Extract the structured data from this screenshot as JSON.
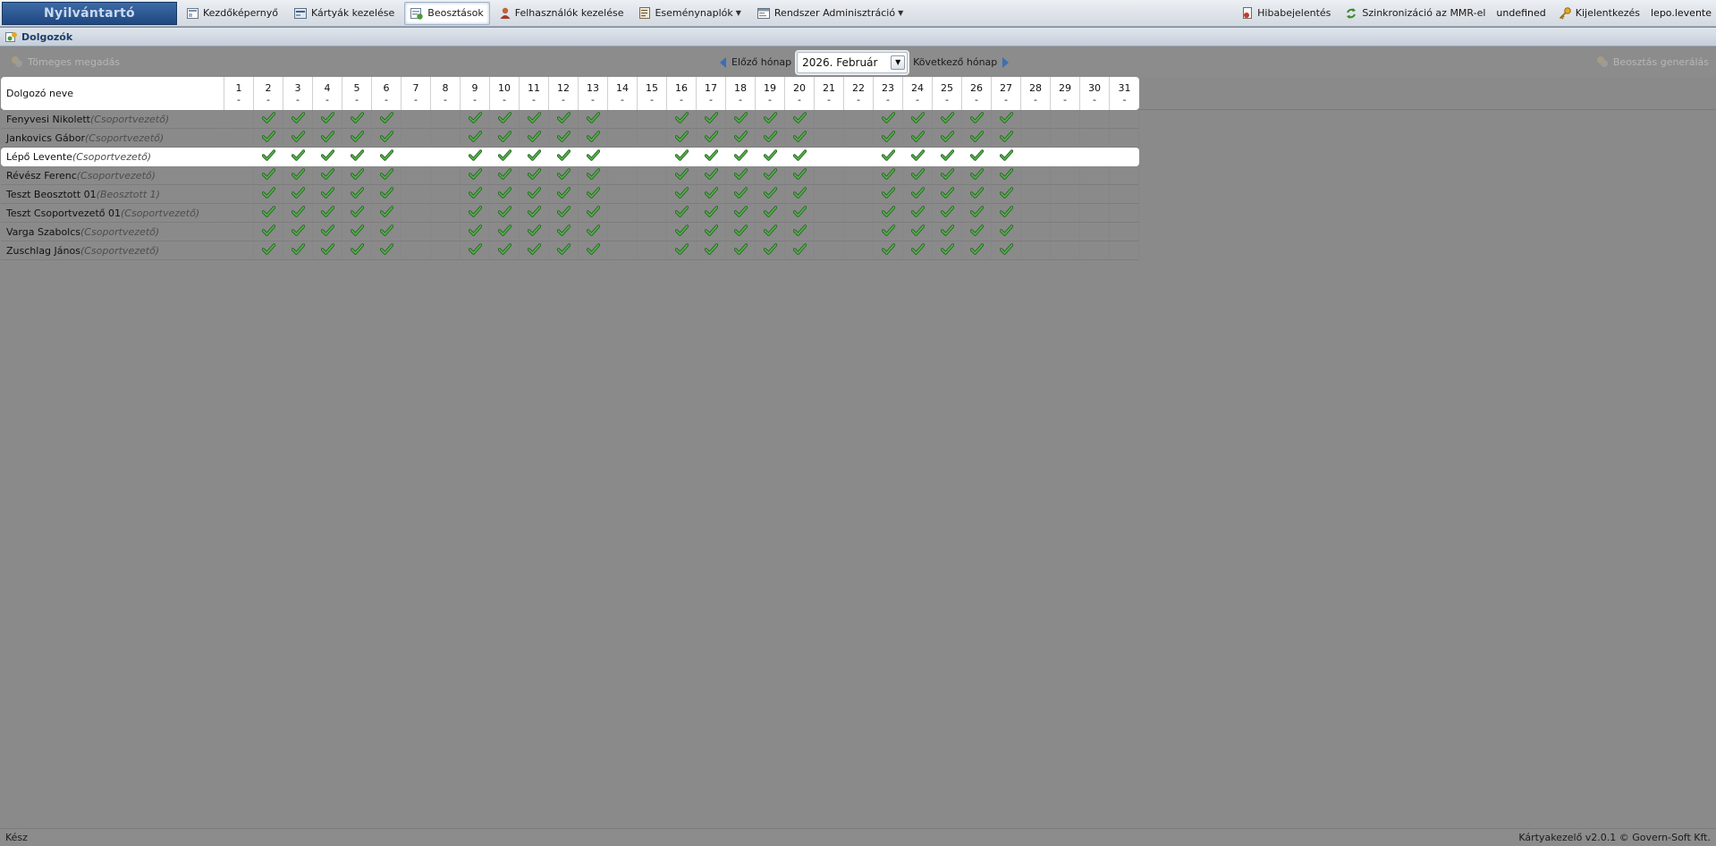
{
  "app": {
    "brand": "Nyilvántartó"
  },
  "menu": {
    "home": "Kezdőképernyő",
    "cards": "Kártyák kezelése",
    "schedules": "Beosztások",
    "users": "Felhasználók kezelése",
    "eventlogs": "Eseménynaplók",
    "sysadmin": "Rendszer Adminisztráció"
  },
  "top_right": {
    "bug_report": "Hibabejelentés",
    "sync": "Szinkronizáció az MMR-el",
    "undefined_label": "undefined",
    "logout": "Kijelentkezés",
    "username": "lepo.levente"
  },
  "section": {
    "title": "Dolgozók"
  },
  "toolbar": {
    "bulk_entry": "Tömeges megadás",
    "prev_month": "Előző hónap",
    "month_value": "2026. Február",
    "next_month": "Következő hónap",
    "generate": "Beosztás generálás"
  },
  "grid": {
    "name_header": "Dolgozó neve",
    "day_sub": "-",
    "days": [
      "1",
      "2",
      "3",
      "4",
      "5",
      "6",
      "7",
      "8",
      "9",
      "10",
      "11",
      "12",
      "13",
      "14",
      "15",
      "16",
      "17",
      "18",
      "19",
      "20",
      "21",
      "22",
      "23",
      "24",
      "25",
      "26",
      "27",
      "28",
      "29",
      "30",
      "31"
    ],
    "checked_days": [
      2,
      3,
      4,
      5,
      6,
      9,
      10,
      11,
      12,
      13,
      16,
      17,
      18,
      19,
      20,
      23,
      24,
      25,
      26,
      27
    ],
    "selected_row": 2,
    "rows": [
      {
        "name": "Fenyvesi Nikolett",
        "role": "(Csoportvezető)"
      },
      {
        "name": "Jankovics Gábor",
        "role": "(Csoportvezető)"
      },
      {
        "name": "Lépő Levente",
        "role": "(Csoportvezető)"
      },
      {
        "name": "Révész Ferenc",
        "role": "(Csoportvezető)"
      },
      {
        "name": "Teszt Beosztott 01",
        "role": "(Beosztott 1)"
      },
      {
        "name": "Teszt Csoportvezető 01",
        "role": "(Csoportvezető)"
      },
      {
        "name": "Varga Szabolcs",
        "role": "(Csoportvezető)"
      },
      {
        "name": "Zuschlag János",
        "role": "(Csoportvezető)"
      }
    ]
  },
  "status": {
    "left": "Kész",
    "right": "Kártyakezelő v2.0.1 © Govern-Soft Kft."
  },
  "colors": {
    "brand_bg": "#1f4880",
    "check_green": "#2e8b2e",
    "overlay_gray": "#8a8a8a"
  }
}
